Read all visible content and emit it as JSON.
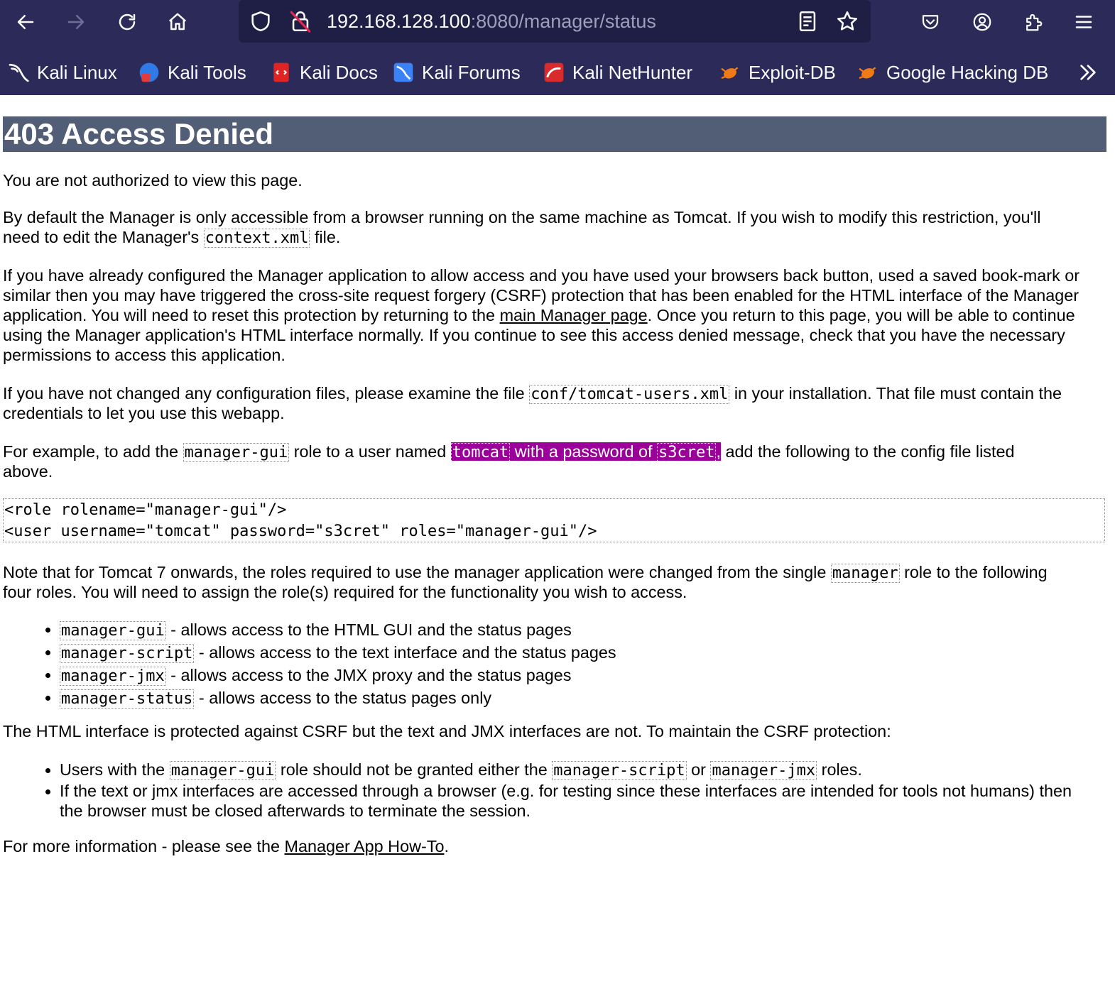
{
  "browser": {
    "url_host": "192.168.128.100",
    "url_path": ":8080/manager/status",
    "bookmarks": [
      "Kali Linux",
      "Kali Tools",
      "Kali Docs",
      "Kali Forums",
      "Kali NetHunter",
      "Exploit-DB",
      "Google Hacking DB"
    ]
  },
  "page": {
    "title": "403 Access Denied",
    "p1": "You are not authorized to view this page.",
    "p2": {
      "l1": "By default the Manager is only accessible from a browser running on the same machine as Tomcat. If you wish to modify this restriction, you'll",
      "l2a": "need to edit the Manager's ",
      "l2code": "context.xml",
      "l2b": " file."
    },
    "p3": {
      "l1": "If you have already configured the Manager application to allow access and you have used your browsers back button, used a saved book-mark or",
      "l2": "similar then you may have triggered the cross-site request forgery (CSRF) protection that has been enabled for the HTML interface of the Manager",
      "l3a": "application. You will need to reset this protection by returning to the ",
      "l3link": "main Manager page",
      "l3b": ". Once you return to this page, you will be able to continue",
      "l4": "using the Manager application's HTML interface normally. If you continue to see this access denied message, check that you have the necessary",
      "l5": "permissions to access this application."
    },
    "p4": {
      "l1a": "If you have not changed any configuration files, please examine the file ",
      "l1code": "conf/tomcat-users.xml",
      "l1b": " in your installation. That file must contain the",
      "l2": "credentials to let you use this webapp."
    },
    "p5": {
      "l1a": "For example, to add the ",
      "l1code": "manager-gui",
      "l1b": " role to a user named ",
      "hl_code1": "tomcat",
      "hl_mid": " with a password of ",
      "hl_code2": "s3cret",
      "hl_end": ",",
      "l1c": " add the following to the config file listed",
      "l2": "above."
    },
    "code_block": {
      "l1": "<role rolename=\"manager-gui\"/>",
      "l2": "<user username=\"tomcat\" password=\"s3cret\" roles=\"manager-gui\"/>"
    },
    "p6": {
      "l1a": "Note that for Tomcat 7 onwards, the roles required to use the manager application were changed from the single ",
      "l1code": "manager",
      "l1b": " role to the following",
      "l2": "four roles. You will need to assign the role(s) required for the functionality you wish to access."
    },
    "roles": [
      {
        "code": "manager-gui",
        "text": " - allows access to the HTML GUI and the status pages"
      },
      {
        "code": "manager-script",
        "text": " - allows access to the text interface and the status pages"
      },
      {
        "code": "manager-jmx",
        "text": " - allows access to the JMX proxy and the status pages"
      },
      {
        "code": "manager-status",
        "text": " - allows access to the status pages only"
      }
    ],
    "p7": "The HTML interface is protected against CSRF but the text and JMX interfaces are not. To maintain the CSRF protection:",
    "csrf": {
      "i1a": "Users with the ",
      "i1code1": "manager-gui",
      "i1b": " role should not be granted either the ",
      "i1code2": "manager-script",
      "i1c": " or ",
      "i1code3": "manager-jmx",
      "i1d": " roles.",
      "i2l1": "If the text or jmx interfaces are accessed through a browser (e.g. for testing since these interfaces are intended for tools not humans) then",
      "i2l2": "the browser must be closed afterwards to terminate the session."
    },
    "p8": {
      "a": "For more information - please see the ",
      "link": "Manager App How-To",
      "b": "."
    }
  }
}
